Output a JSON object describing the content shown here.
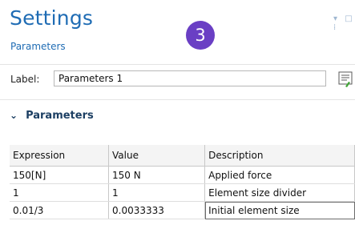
{
  "header": {
    "title": "Settings",
    "subtitle": "Parameters",
    "badge": "3",
    "window_controls": "▾ □ ⁞"
  },
  "label_field": {
    "label": "Label:",
    "value": "Parameters 1",
    "button_icon": "edit-list-icon"
  },
  "section": {
    "title": "Parameters",
    "expanded": true,
    "icon": "chevron-down-icon"
  },
  "table": {
    "headers": [
      "Expression",
      "Value",
      "Description"
    ],
    "rows": [
      {
        "expression": "150[N]",
        "value": "150 N",
        "description": "Applied force"
      },
      {
        "expression": "1",
        "value": "1",
        "description": "Element size divider"
      },
      {
        "expression": "0.01/3",
        "value": "0.0033333",
        "description": "Initial element size"
      }
    ]
  },
  "colors": {
    "title": "#1f6cb4",
    "badge_bg": "#6a3fc4",
    "section_title": "#1c3f63"
  }
}
